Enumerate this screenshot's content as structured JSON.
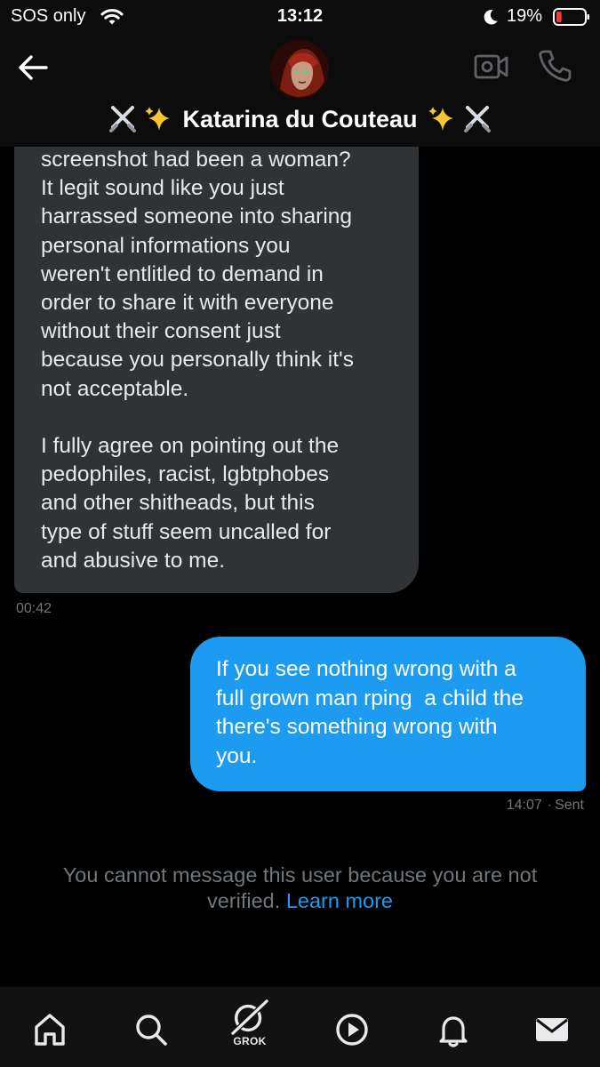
{
  "status_bar": {
    "carrier": "SOS only",
    "time": "13:12",
    "battery_percent": "19%",
    "battery_level": 0.19,
    "icons": [
      "wifi-icon",
      "moon-icon",
      "battery-icon"
    ]
  },
  "header": {
    "title": "Katarina du Couteau",
    "title_emoji_left": [
      "crossed-swords-icon",
      "sparkles-icon"
    ],
    "title_emoji_right": [
      "sparkles-icon",
      "crossed-swords-icon"
    ],
    "icons": [
      "back-arrow-icon",
      "video-call-icon",
      "phone-call-icon"
    ]
  },
  "messages": [
    {
      "direction": "incoming",
      "text": "screenshot had been a woman?\nIt legit sound like you just\nharrassed someone into sharing\npersonal informations you\nweren't entlitled to demand in\norder to share it with everyone\nwithout their consent just\nbecause you personally think it's\nnot acceptable.\n\nI fully agree on pointing out the\npedophiles, racist, lgbtphobes\nand other shitheads, but this\ntype of stuff seem uncalled for\nand abusive to me.",
      "timestamp": "00:42"
    },
    {
      "direction": "outgoing",
      "text": "If you see nothing wrong with a\nfull grown man rping  a child the\nthere's something wrong with\nyou.",
      "timestamp": "14:07",
      "status": "Sent"
    }
  ],
  "notice": {
    "text": "You cannot message this user because you are not verified.",
    "link": "Learn more"
  },
  "bottom_nav": {
    "grok_label": "GROK",
    "items": [
      "home-icon",
      "search-icon",
      "grok-icon",
      "video-play-icon",
      "notifications-bell-icon",
      "messages-envelope-icon"
    ]
  },
  "colors": {
    "background": "#000000",
    "incoming_bubble": "#2f3336",
    "outgoing_bubble": "#1d9bf0",
    "link": "#1d9bf0",
    "muted_text": "#71767b",
    "battery_low": "#ff3b30"
  }
}
